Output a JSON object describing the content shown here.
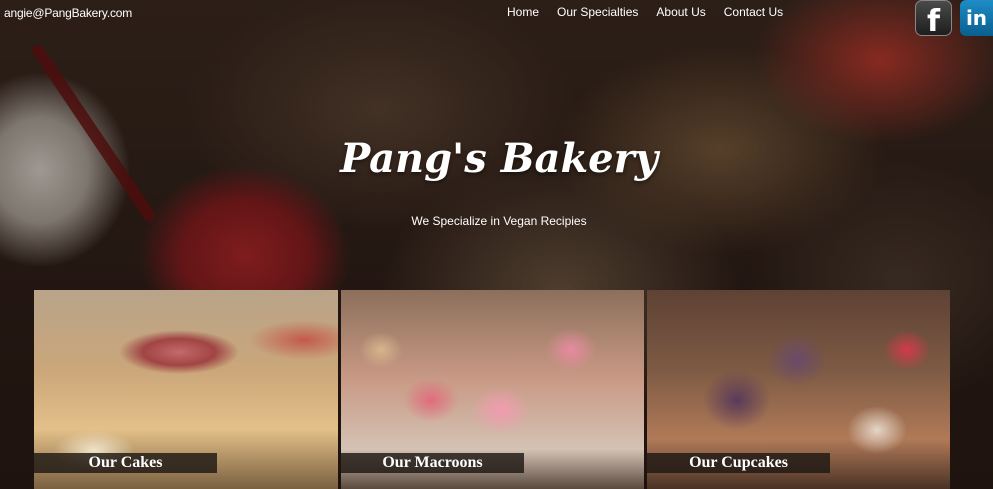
{
  "header": {
    "email": "angie@PangBakery.com",
    "nav": [
      "Home",
      "Our Specialties",
      "About Us",
      "Contact Us"
    ],
    "social": [
      {
        "name": "facebook-icon",
        "glyph": "f"
      },
      {
        "name": "linkedin-icon",
        "glyph": "in"
      }
    ]
  },
  "hero": {
    "title": "Pang's Bakery",
    "subtitle": "We Specialize in Vegan Recipies"
  },
  "cards": [
    {
      "caption": "Our Cakes"
    },
    {
      "caption": "Our Macroons"
    },
    {
      "caption": "Our Cupcakes"
    }
  ]
}
